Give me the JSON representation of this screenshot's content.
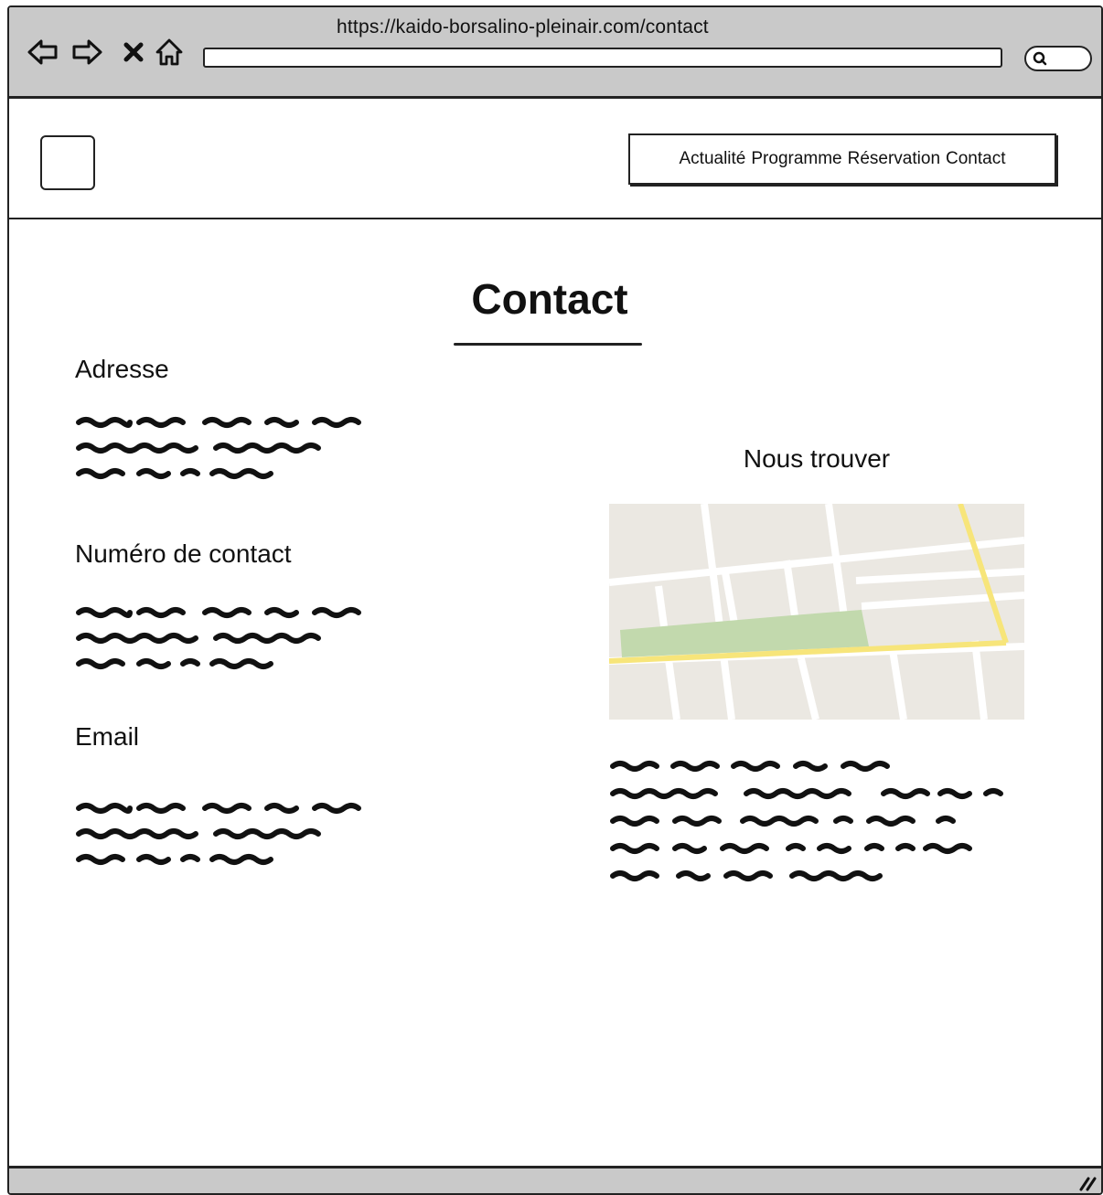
{
  "browser": {
    "url": "https://kaido-borsalino-pleinair.com/contact"
  },
  "nav": {
    "items": [
      "Actualité",
      "Programme",
      "Réservation",
      "Contact"
    ]
  },
  "page": {
    "title": "Contact"
  },
  "sections": {
    "address_heading": "Adresse",
    "phone_heading": "Numéro de contact",
    "email_heading": "Email",
    "find_us_heading": "Nous trouver"
  },
  "icons": {
    "back": "back-arrow-icon",
    "forward": "forward-arrow-icon",
    "stop": "close-icon",
    "home": "home-icon",
    "search": "search-icon",
    "resize": "resize-grip-icon"
  },
  "colors": {
    "chrome": "#c9c9c9",
    "map_bg": "#ebe8e2",
    "map_road_major": "#f7e57a",
    "map_park": "#c2d9ad"
  }
}
